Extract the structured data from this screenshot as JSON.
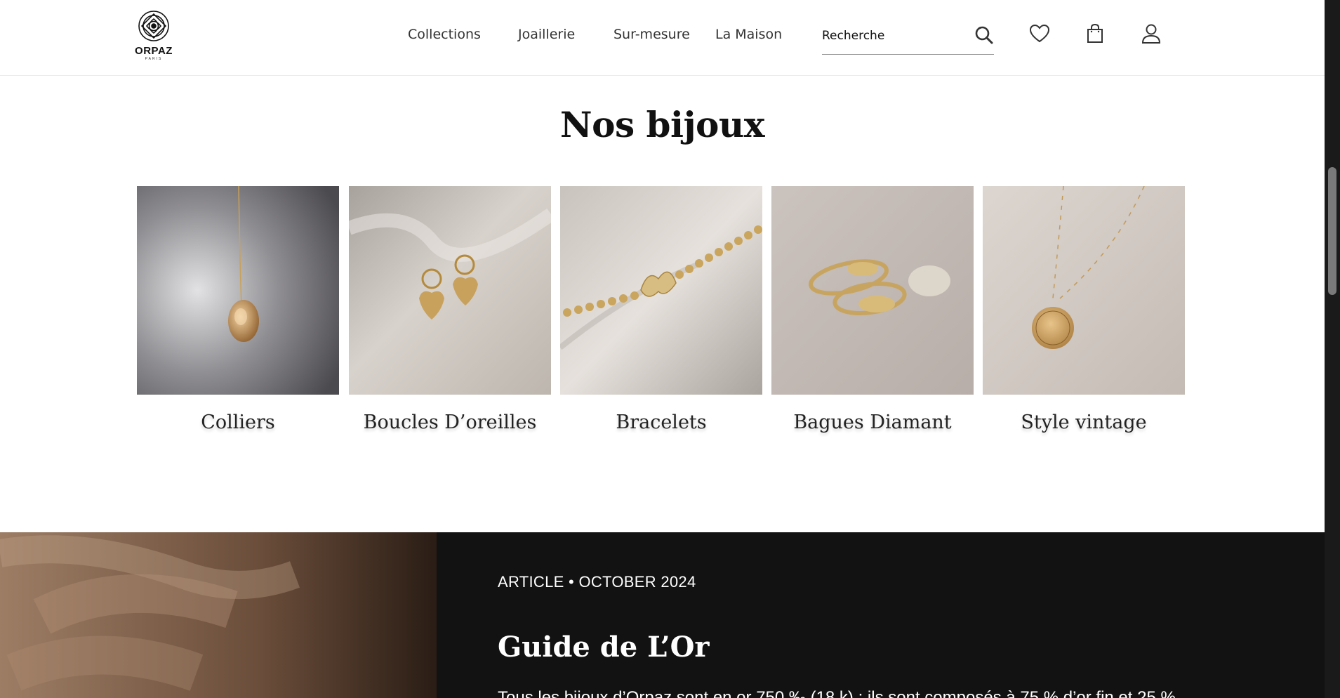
{
  "brand": {
    "name": "ORPAZ",
    "city": "PARIS"
  },
  "nav": {
    "items": [
      {
        "label": "Collections"
      },
      {
        "label": "Joaillerie"
      },
      {
        "label": "Sur-mesure"
      },
      {
        "label": "La Maison"
      }
    ],
    "search_placeholder": "Recherche"
  },
  "header_icons": [
    "search-icon",
    "heart-icon",
    "shopping-bag-icon",
    "user-icon"
  ],
  "section": {
    "title": "Nos bijoux"
  },
  "products": [
    {
      "label": "Colliers"
    },
    {
      "label": "Boucles D’oreilles"
    },
    {
      "label": "Bracelets"
    },
    {
      "label": "Bagues Diamant"
    },
    {
      "label": "Style vintage"
    }
  ],
  "article": {
    "meta": "ARTICLE • OCTOBER 2024",
    "title": "Guide de L’Or",
    "body": "Tous les bijoux d’Orpaz sont en or 750 ‰ (18 k) : ils sont composés à 75 % d’or fin et 25 %"
  },
  "colors": {
    "article_bg": "#121212",
    "text": "#222222",
    "scrollbar": "#1a1a1a"
  }
}
